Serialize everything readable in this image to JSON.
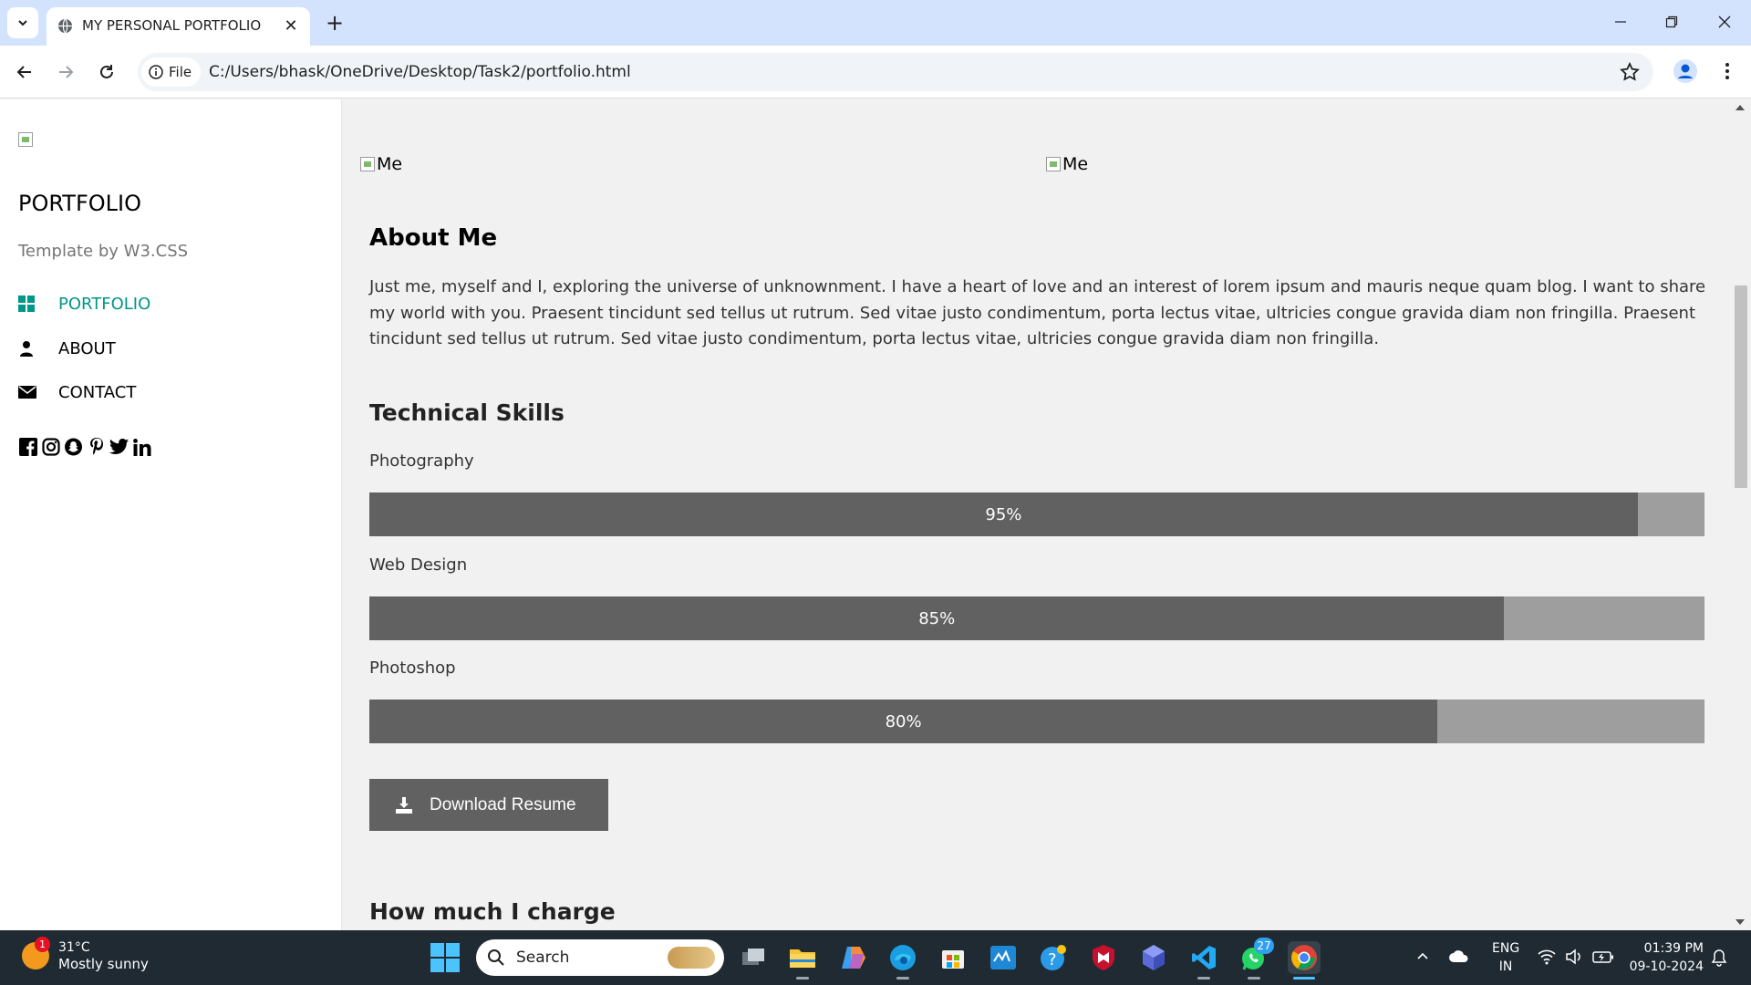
{
  "browser": {
    "tab_title": "MY PERSONAL PORTFOLIO",
    "file_chip_label": "File",
    "url": "C:/Users/bhask/OneDrive/Desktop/Task2/portfolio.html"
  },
  "sidebar": {
    "title": "PORTFOLIO",
    "subtitle": "Template by W3.CSS",
    "links": [
      {
        "label": "PORTFOLIO",
        "icon": "grid-icon",
        "active": true
      },
      {
        "label": "ABOUT",
        "icon": "user-icon",
        "active": false
      },
      {
        "label": "CONTACT",
        "icon": "envelope-icon",
        "active": false
      }
    ],
    "social_icons": [
      "facebook-icon",
      "instagram-icon",
      "snapchat-icon",
      "pinterest-icon",
      "twitter-icon",
      "linkedin-icon"
    ]
  },
  "main": {
    "image_alt_1": "Me",
    "image_alt_2": "Me",
    "about_heading": "About Me",
    "about_text": "Just me, myself and I, exploring the universe of unknownment. I have a heart of love and an interest of lorem ipsum and mauris neque quam blog. I want to share my world with you. Praesent tincidunt sed tellus ut rutrum. Sed vitae justo condimentum, porta lectus vitae, ultricies congue gravida diam non fringilla. Praesent tincidunt sed tellus ut rutrum. Sed vitae justo condimentum, porta lectus vitae, ultricies congue gravida diam non fringilla.",
    "skills_heading": "Technical Skills",
    "skills": [
      {
        "name": "Photography",
        "percent_label": "95%",
        "percent": 95
      },
      {
        "name": "Web Design",
        "percent_label": "85%",
        "percent": 85
      },
      {
        "name": "Photoshop",
        "percent_label": "80%",
        "percent": 80
      }
    ],
    "download_label": "Download Resume",
    "charge_heading": "How much I charge"
  },
  "taskbar": {
    "weather_temp": "31°C",
    "weather_desc": "Mostly sunny",
    "weather_badge": "1",
    "search_label": "Search",
    "whatsapp_badge": "27",
    "lang_line1": "ENG",
    "lang_line2": "IN",
    "time": "01:39 PM",
    "date": "09-10-2024"
  },
  "colors": {
    "accent": "#009688",
    "bar_fill": "#616161",
    "bar_track": "#9e9e9e",
    "tabbar": "#d3e3fd",
    "taskbar": "#1f2a33"
  }
}
